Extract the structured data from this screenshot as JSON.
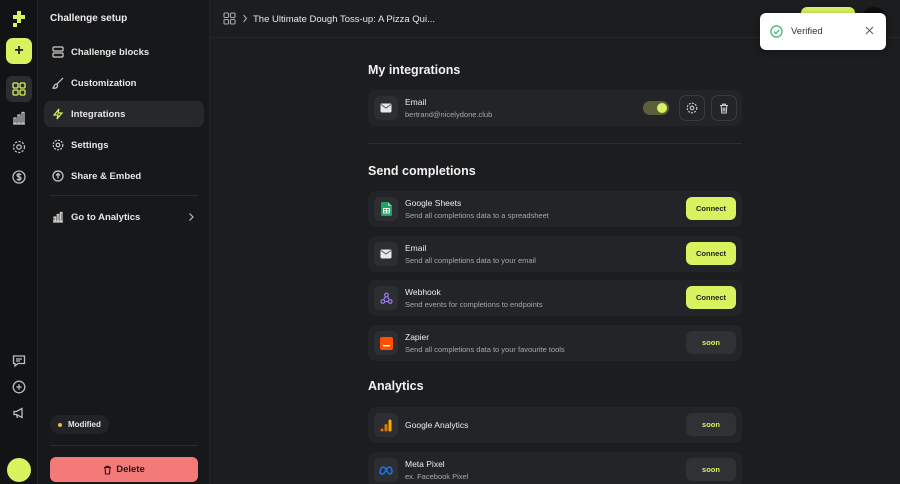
{
  "sidebar": {
    "title": "Challenge setup",
    "items": [
      {
        "label": "Challenge blocks"
      },
      {
        "label": "Customization"
      },
      {
        "label": "Integrations"
      },
      {
        "label": "Settings"
      },
      {
        "label": "Share & Embed"
      }
    ],
    "analytics_link": "Go to Analytics",
    "status_badge": "Modified",
    "delete_label": "Delete"
  },
  "header": {
    "breadcrumb": "The Ultimate Dough Toss-up: A Pizza Qui..."
  },
  "toast": {
    "label": "Verified"
  },
  "my_integrations": {
    "title": "My integrations",
    "items": [
      {
        "name": "Email",
        "detail": "bertrand@nicelydone.club",
        "enabled": true
      }
    ]
  },
  "send_completions": {
    "title": "Send completions",
    "items": [
      {
        "name": "Google Sheets",
        "description": "Send all completions data to a spreadsheet",
        "action": "Connect"
      },
      {
        "name": "Email",
        "description": "Send all completions data to your email",
        "action": "Connect"
      },
      {
        "name": "Webhook",
        "description": "Send events for completions to endpoints",
        "action": "Connect"
      },
      {
        "name": "Zapier",
        "description": "Send all completions data to your favourite tools",
        "action": "soon"
      }
    ]
  },
  "analytics": {
    "title": "Analytics",
    "items": [
      {
        "name": "Google Analytics",
        "action": "soon"
      },
      {
        "name": "Meta Pixel",
        "description": "ex. Facebook Pixel",
        "action": "soon"
      }
    ]
  },
  "colors": {
    "accent": "#d7f460",
    "danger": "#f47a7a",
    "background": "#1c1d1f",
    "card": "#232427",
    "success": "#3cb371"
  }
}
